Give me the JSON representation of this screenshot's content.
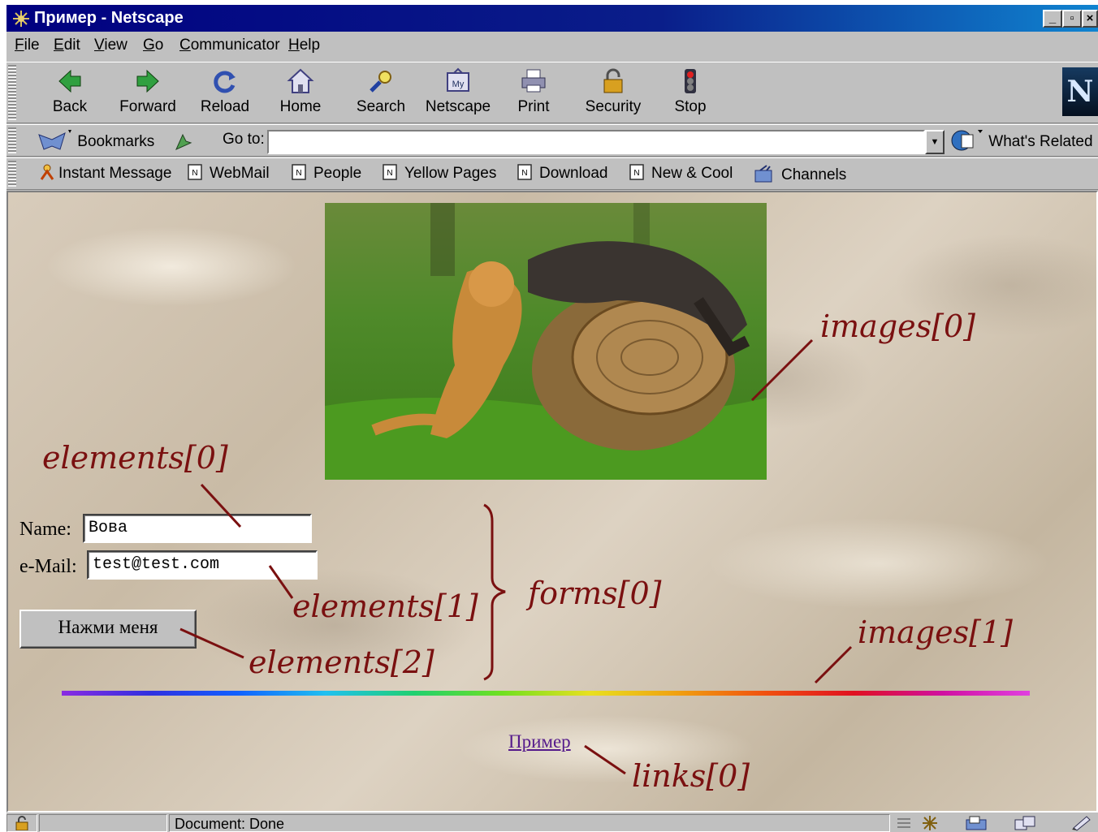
{
  "window": {
    "title": "Пример - Netscape"
  },
  "menu": [
    {
      "label": "File",
      "accel": "F",
      "rest": "ile"
    },
    {
      "label": "Edit",
      "accel": "E",
      "rest": "dit"
    },
    {
      "label": "View",
      "accel": "V",
      "rest": "iew"
    },
    {
      "label": "Go",
      "accel": "G",
      "rest": "o"
    },
    {
      "label": "Communicator",
      "accel": "C",
      "rest": "ommunicator"
    },
    {
      "label": "Help",
      "accel": "H",
      "rest": "elp"
    }
  ],
  "nav_toolbar": {
    "back": "Back",
    "forward": "Forward",
    "reload": "Reload",
    "home": "Home",
    "search": "Search",
    "netscape": "Netscape",
    "print": "Print",
    "security": "Security",
    "stop": "Stop",
    "logo": "N"
  },
  "location_toolbar": {
    "bookmarks": "Bookmarks",
    "goto_label": "Go to:",
    "goto_value": "",
    "whats_related": "What's Related"
  },
  "personal_toolbar": {
    "instant_message": "Instant Message",
    "webmail": "WebMail",
    "people": "People",
    "yellow_pages": "Yellow Pages",
    "download": "Download",
    "new_cool": "New & Cool",
    "channels": "Channels"
  },
  "page": {
    "name_label": "Name:",
    "name_value": "Вова",
    "email_label": "e-Mail:",
    "email_value": "test@test.com",
    "button_label": "Нажми меня",
    "link_text": "Пример"
  },
  "annotations": {
    "images0": "images[0]",
    "images1": "images[1]",
    "elements0": "elements[0]",
    "elements1": "elements[1]",
    "elements2": "elements[2]",
    "forms0": "forms[0]",
    "links0": "links[0]",
    "color": "#7a1010"
  },
  "status": {
    "text": "Document: Done"
  },
  "icons": [
    "netscape-app-icon",
    "back-icon",
    "forward-icon",
    "reload-icon",
    "home-icon",
    "search-icon",
    "my-netscape-icon",
    "print-icon",
    "security-icon",
    "stop-icon",
    "bookmarks-icon",
    "location-icon",
    "whats-related-icon",
    "instant-message-icon",
    "bookmark-page-icon",
    "channels-icon"
  ]
}
